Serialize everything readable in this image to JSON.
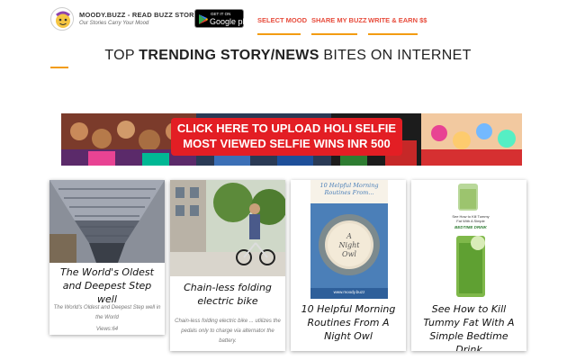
{
  "site": {
    "title": "MOODY.BUZZ - READ BUZZ STORIES",
    "tagline": "Our Stories Carry Your Mood"
  },
  "store_badge": {
    "top": "GET IT ON",
    "main": "Google play"
  },
  "nav": {
    "items": [
      {
        "label": "SELECT MOOD"
      },
      {
        "label": "SHARE MY BUZZ"
      },
      {
        "label": "WRITE & EARN $$"
      }
    ]
  },
  "headline": {
    "part1": "TOP ",
    "bold": "TRENDING STORY/NEWS",
    "part2": " BITES ON INTERNET"
  },
  "banner": {
    "line1": "CLICK HERE TO UPLOAD HOLI SELFIE",
    "line2": "MOST VIEWED SELFIE WINS INR 500",
    "accent_color": "#e31e24"
  },
  "cards": [
    {
      "title": "The World's Oldest and Deepest Step well",
      "desc": "The World's Oldest and Deepest Step well in the World",
      "views": "Views:64"
    },
    {
      "title": "Chain-less folding electric bike",
      "desc": "Chain-less folding electric bike ... utilizes the pedals only to charge via alternator the battery."
    },
    {
      "title": "10 Helpful Morning Routines From A Night Owl",
      "image_text": {
        "heading": "10 Helpful Morning Routines From...",
        "cup1": "A",
        "cup2": "Night",
        "cup3": "Owl",
        "footer": "www.moody.buzz"
      }
    },
    {
      "title": "See How to Kill Tummy Fat With A Simple Bedtime Drink",
      "image_text": {
        "caption1": "See How to Kill Tummy Fat With A Simple",
        "caption2": "BEDTIME DRINK"
      }
    }
  ],
  "colors": {
    "nav_text": "#e74c3c",
    "nav_underline": "#f39c12",
    "owl_image_bg": "#4b7fb8"
  }
}
